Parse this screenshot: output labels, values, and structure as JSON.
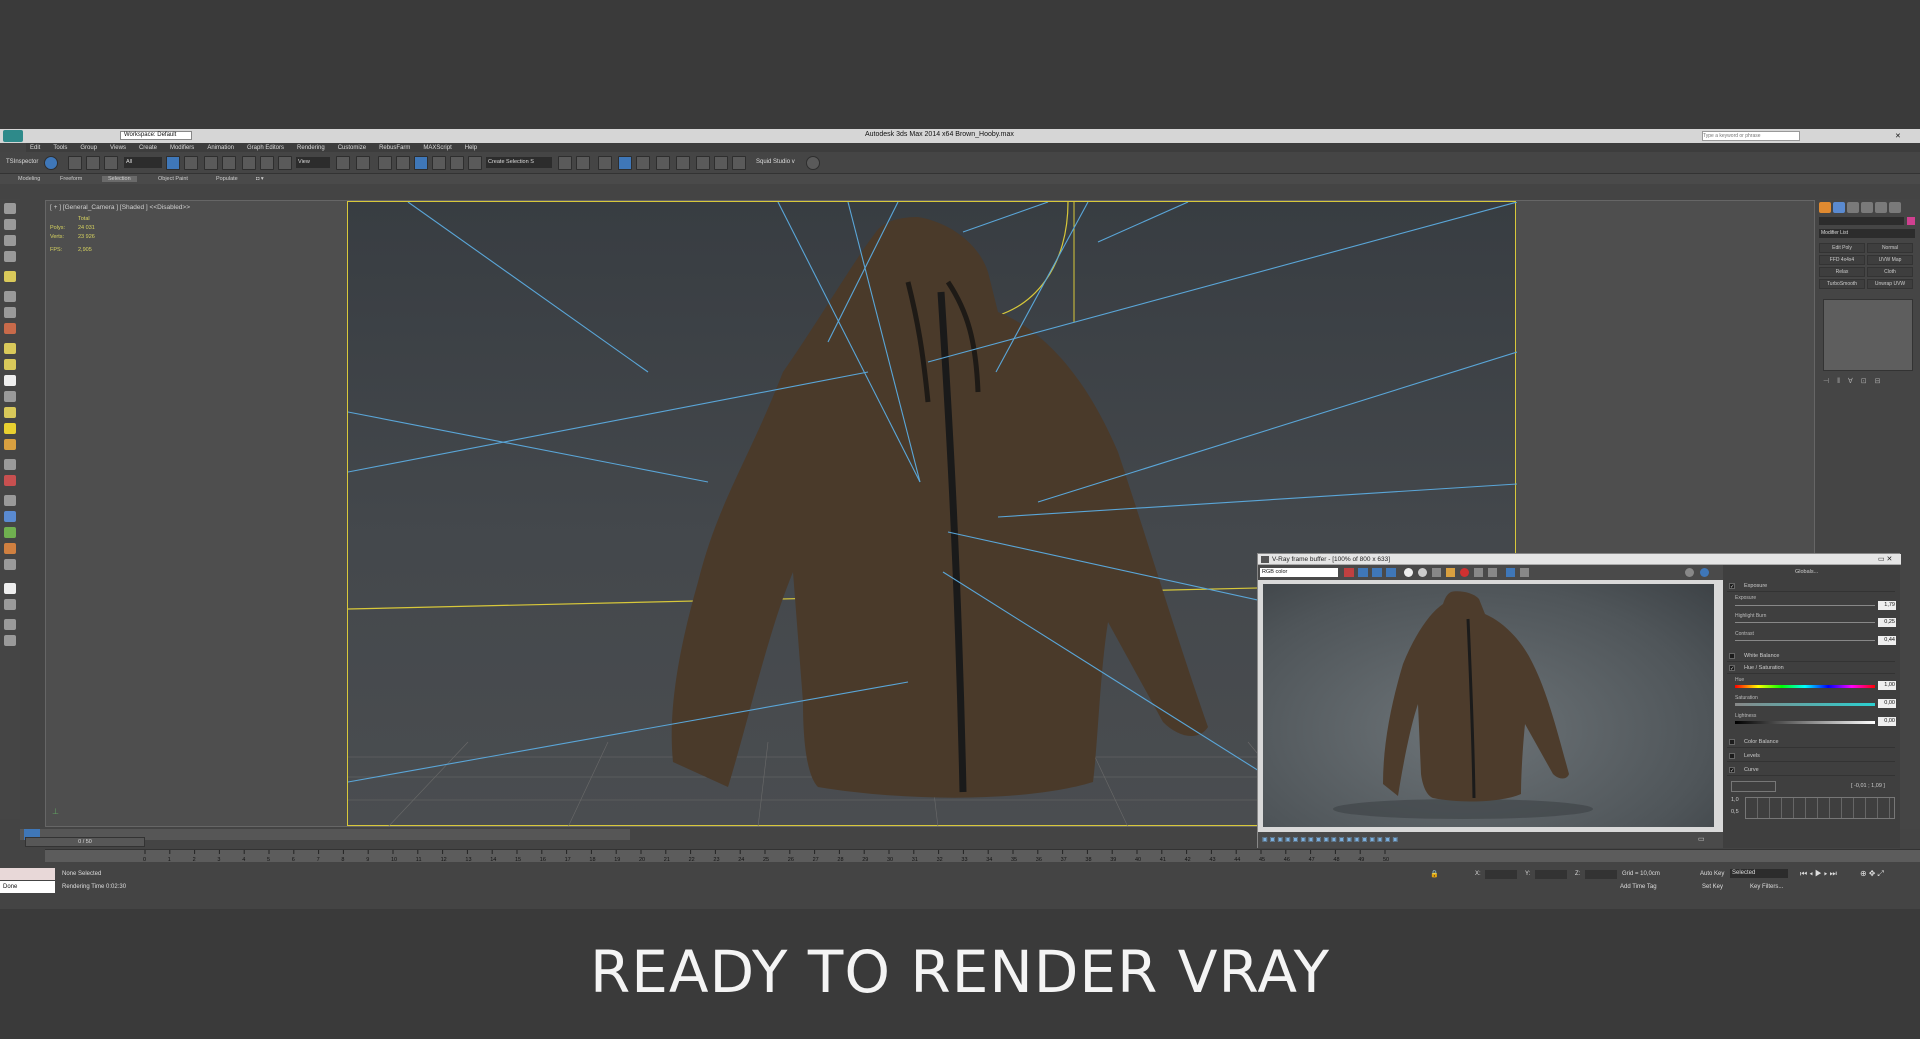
{
  "titlebar": {
    "title": "Autodesk 3ds Max  2014 x64     Brown_Hooby.max",
    "workspace": "Workspace: Default",
    "search_placeholder": "Type a keyword or phrase"
  },
  "menu": [
    "Edit",
    "Tools",
    "Group",
    "Views",
    "Create",
    "Modifiers",
    "Animation",
    "Graph Editors",
    "Rendering",
    "Customize",
    "RebusFarm",
    "MAXScript",
    "Help"
  ],
  "toolbar": {
    "inspector": "TSInspector",
    "filter": "All",
    "ref_coord": "View",
    "selection_set": "Create Selection S",
    "studio": "Squid Studio v"
  },
  "ribbon": {
    "tabs": [
      "Modeling",
      "Freeform",
      "Selection",
      "Object Paint",
      "Populate"
    ],
    "active": "Selection"
  },
  "viewport": {
    "label": "[ + ] [General_Camera ] [Shaded ]  <<Disabled>>",
    "stats_total": "Total",
    "polys_label": "Polys:",
    "polys": "24 031",
    "verts_label": "Verts:",
    "verts": "23 926",
    "fps_label": "FPS:",
    "fps": "2,905"
  },
  "command_panel": {
    "modifier_list": "Modifier List",
    "buttons": [
      "Edit Poly",
      "Normal",
      "FFD 4x4x4",
      "UVW Map",
      "Relax",
      "Cloth",
      "TurboSmooth",
      "Unwrap UVW"
    ]
  },
  "timeline": {
    "slider": "0 / 50",
    "ticks": [
      "0",
      "1",
      "2",
      "3",
      "4",
      "5",
      "6",
      "7",
      "8",
      "9",
      "10",
      "11",
      "12",
      "13",
      "14",
      "15",
      "16",
      "17",
      "18",
      "19",
      "20",
      "21",
      "22",
      "23",
      "24",
      "25",
      "26",
      "27",
      "28",
      "29",
      "30",
      "31",
      "32",
      "33",
      "34",
      "35",
      "36",
      "37",
      "38",
      "39",
      "40",
      "41",
      "42",
      "43",
      "44",
      "45",
      "46",
      "47",
      "48",
      "49",
      "50"
    ]
  },
  "status": {
    "maxscript": "Done",
    "selection": "None Selected",
    "render_time": "Rendering Time  0:02:30",
    "x_label": "X:",
    "y_label": "Y:",
    "z_label": "Z:",
    "grid": "Grid = 10,0cm",
    "add_time_tag": "Add Time Tag",
    "auto_key": "Auto Key",
    "auto_key_value": "Selected",
    "set_key": "Set Key",
    "key_filters": "Key Filters..."
  },
  "vfb": {
    "title": "V-Ray frame buffer - [100% of 800 x 633]",
    "channel": "RGB color",
    "globals": "Globals...",
    "exposure_section": "Exposure",
    "exposure_label": "Exposure",
    "exposure": "1,79",
    "highlight_label": "Highlight Burn",
    "highlight": "0,25",
    "contrast_label": "Contrast",
    "contrast": "0,44",
    "white_balance": "White Balance",
    "hue_sat": "Hue / Saturation",
    "hue_label": "Hue",
    "hue": "1,00",
    "sat_label": "Saturation",
    "sat": "0,00",
    "light_label": "Lightness",
    "light": "0,00",
    "color_balance": "Color Balance",
    "levels": "Levels",
    "curve": "Curve",
    "curve_coords": "[ -0,01 ; 1,09 ]",
    "curve_top": "1,0",
    "curve_bottom": "0,5"
  },
  "caption": "READY TO RENDER VRAY",
  "colors": {
    "accent": "#3f77b8",
    "camera_frame": "#d8c83a",
    "light_lines": "#5aa6d8",
    "hoodie": "#4a3a2a"
  }
}
